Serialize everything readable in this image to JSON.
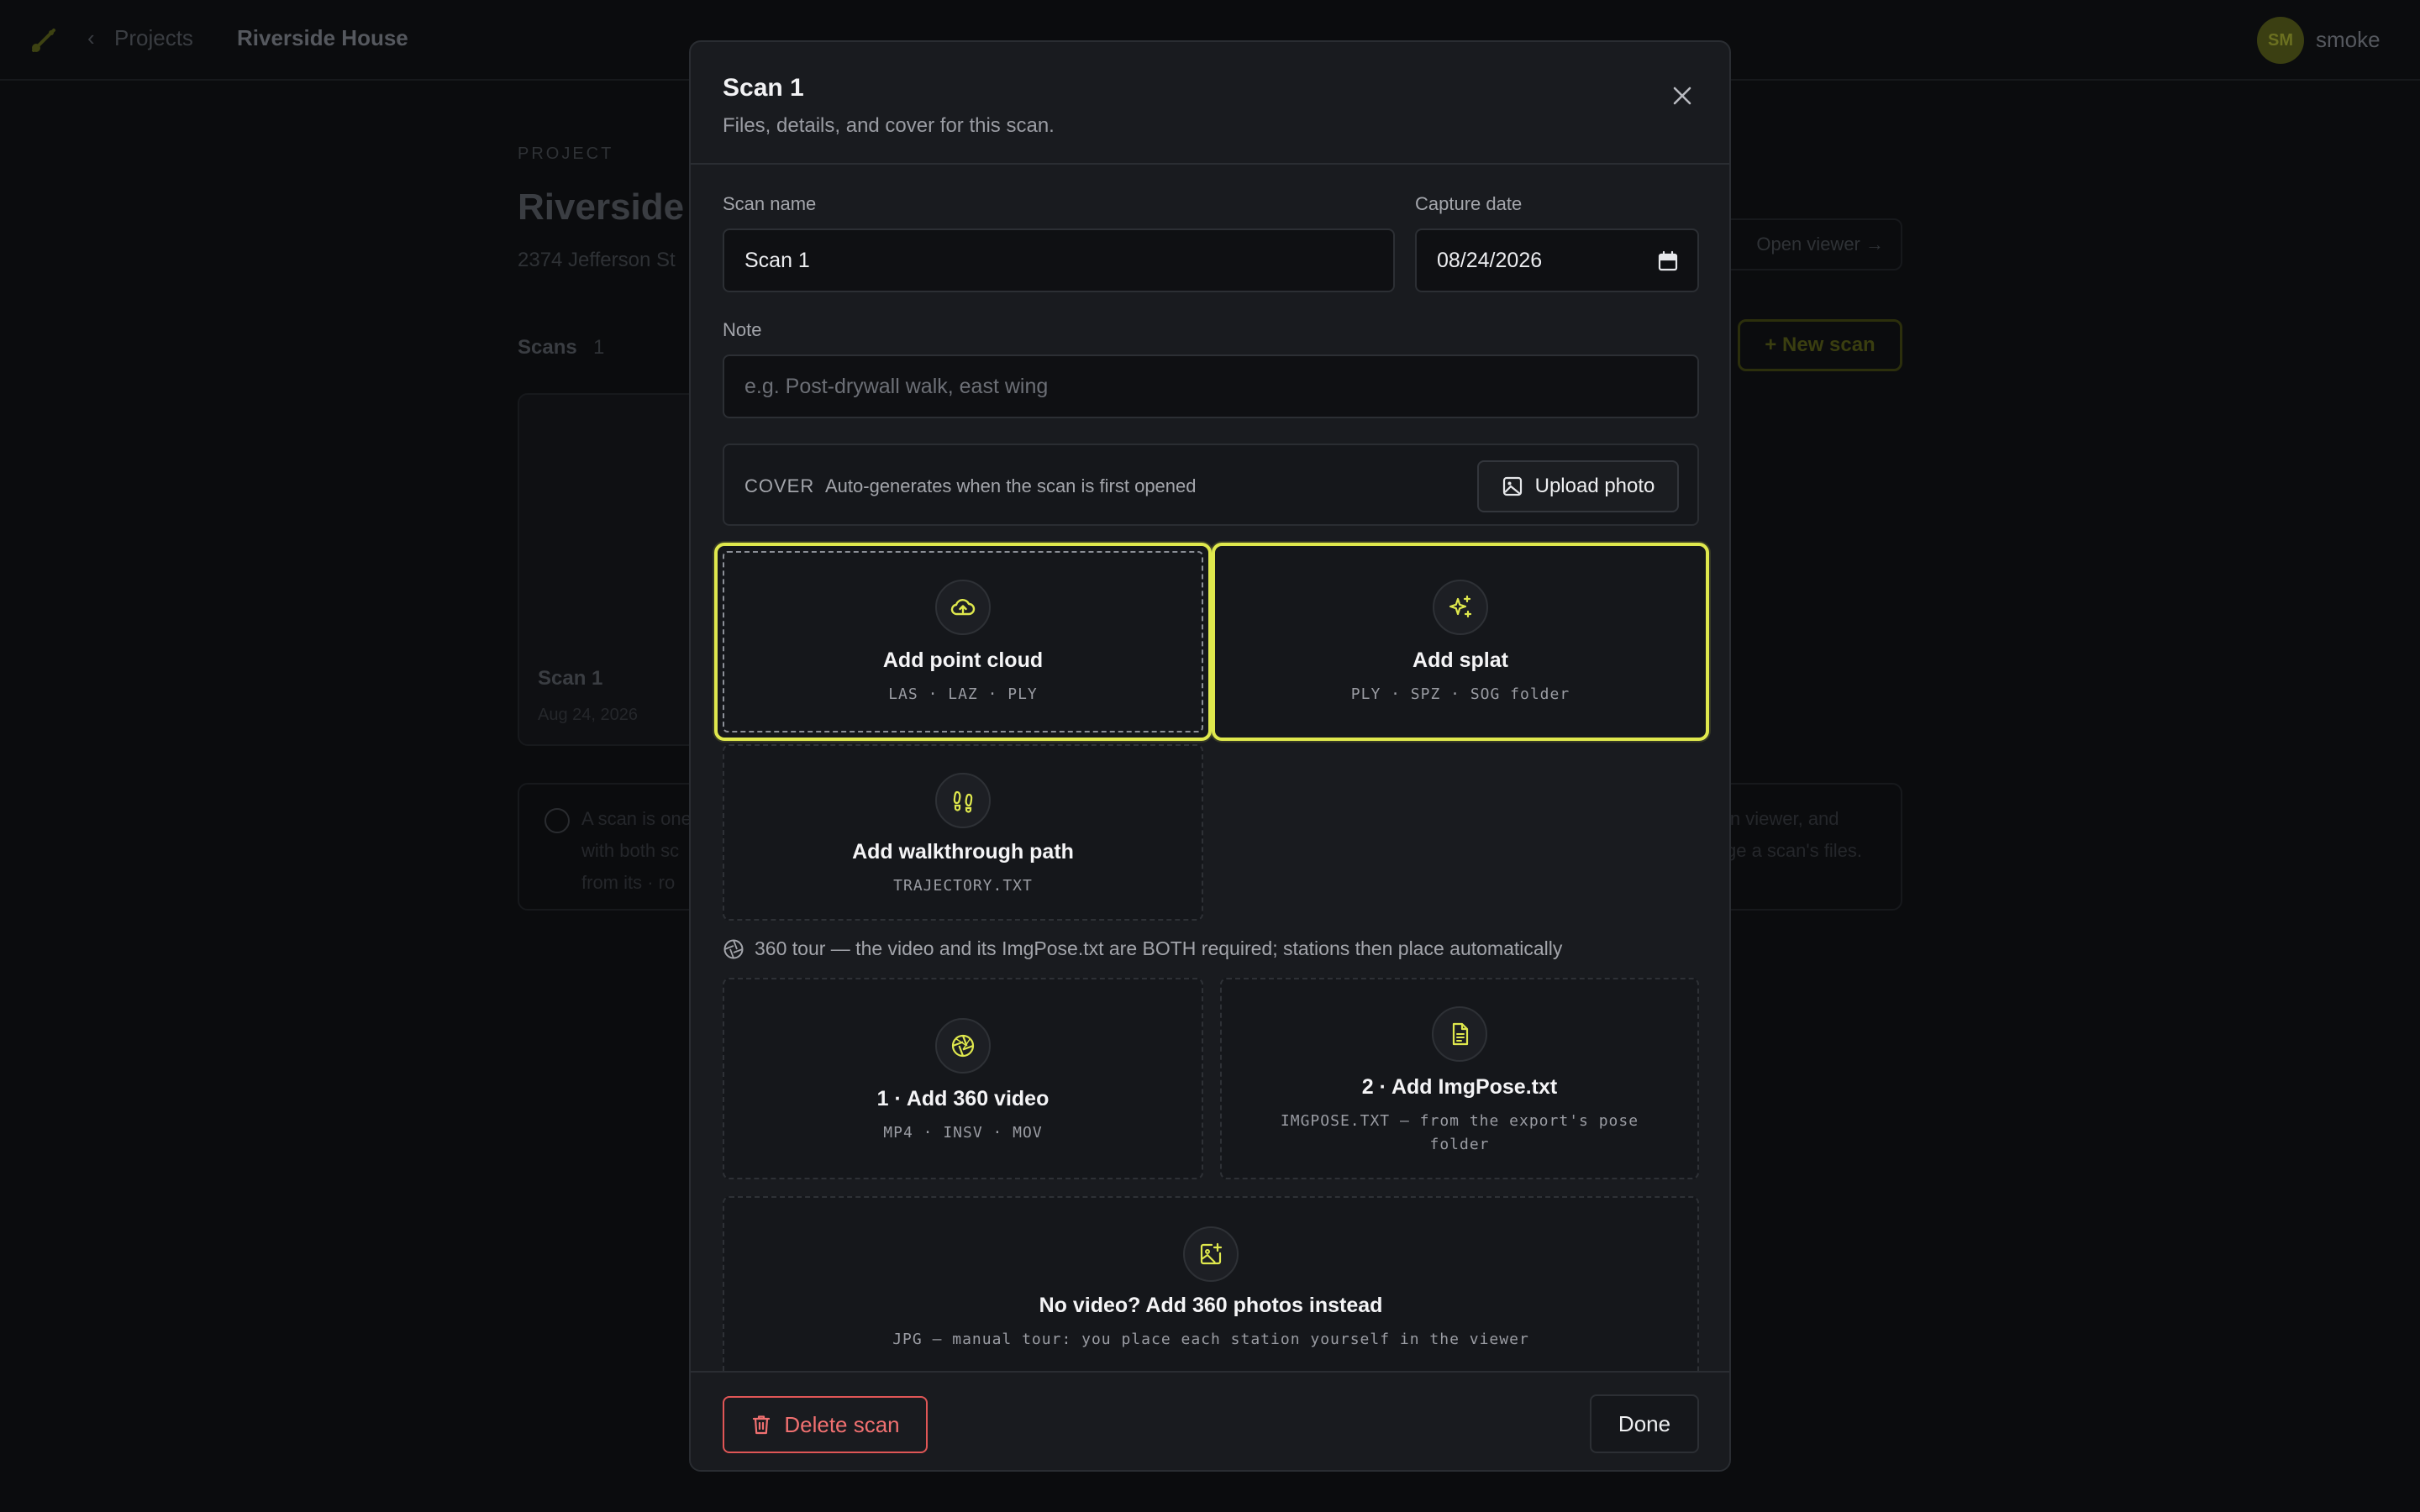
{
  "background": {
    "crumb_back": "‹",
    "crumb_projects": "Projects",
    "crumb_current": "Riverside House",
    "avatar_initials": "SM",
    "username": "smoke",
    "kicker": "PROJECT",
    "title": "Riverside H",
    "subtitle": "2374 Jefferson St",
    "scans_label": "Scans",
    "scans_count": "1",
    "card_title": "Scan 1",
    "card_date": "Aug 24, 2026",
    "viewer_label": "Open viewer →",
    "new_scan_label": "+ New scan",
    "info_line1": "A scan is one",
    "info_line2": "with both sc",
    "info_line3": "from its · ro",
    "info_right1": "in viewer, and",
    "info_right2": "ge a scan's files."
  },
  "modal": {
    "title": "Scan 1",
    "subtitle": "Files, details, and cover for this scan.",
    "scan_name_label": "Scan name",
    "scan_name_value": "Scan 1",
    "capture_date_label": "Capture date",
    "capture_date_value": "08/24/2026",
    "note_label": "Note",
    "note_placeholder": "e.g. Post-drywall walk, east wing",
    "cover_key": "COVER",
    "cover_text": "Auto-generates when the scan is first opened",
    "upload_label": "Upload photo",
    "tiles": {
      "point_cloud": {
        "title": "Add point cloud",
        "formats": "LAS · LAZ · PLY"
      },
      "splat": {
        "title": "Add splat",
        "formats": "PLY · SPZ · SOG folder"
      },
      "walkthrough": {
        "title": "Add walkthrough path",
        "formats": "TRAJECTORY.TXT"
      },
      "video360": {
        "title": "1 · Add 360 video",
        "formats": "MP4 · INSV · MOV"
      },
      "imgpose": {
        "title": "2 · Add ImgPose.txt",
        "formats_line1": "IMGPOSE.TXT — from the export's pose",
        "formats_line2": "folder"
      },
      "photos360": {
        "title": "No video? Add 360 photos instead",
        "formats": "JPG — manual tour: you place each station yourself in the viewer"
      }
    },
    "tour_note": "360 tour — the video and its ImgPose.txt are BOTH required; stations then place automatically",
    "delete_label": "Delete scan",
    "done_label": "Done"
  },
  "colors": {
    "accent": "#dfe84d",
    "danger": "#e05656",
    "surface": "#191b1f",
    "backdrop": "#0b0c0e"
  }
}
